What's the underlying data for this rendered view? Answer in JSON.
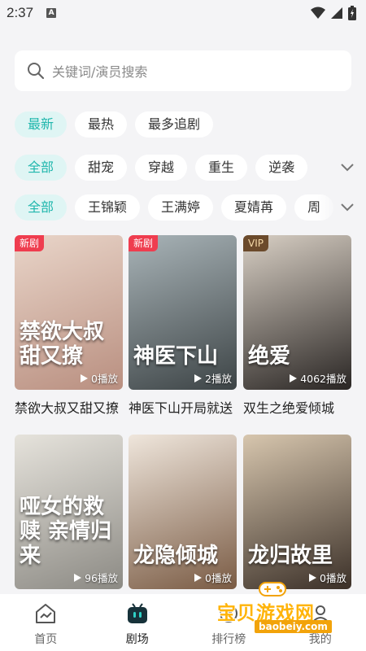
{
  "status": {
    "time": "2:37"
  },
  "search": {
    "placeholder": "关键词/演员搜索"
  },
  "sort_tabs": [
    {
      "label": "最新",
      "active": true
    },
    {
      "label": "最热",
      "active": false
    },
    {
      "label": "最多追剧",
      "active": false
    }
  ],
  "genre_tabs": [
    {
      "label": "全部",
      "active": true
    },
    {
      "label": "甜宠",
      "active": false
    },
    {
      "label": "穿越",
      "active": false
    },
    {
      "label": "重生",
      "active": false
    },
    {
      "label": "逆袭",
      "active": false
    }
  ],
  "actor_tabs": [
    {
      "label": "全部",
      "active": true
    },
    {
      "label": "王锦颖",
      "active": false
    },
    {
      "label": "王满婷",
      "active": false
    },
    {
      "label": "夏婧苒",
      "active": false
    },
    {
      "label": "周",
      "active": false
    }
  ],
  "dramas": [
    {
      "title": "禁欲大叔又甜又撩",
      "badge": "新剧",
      "badge_type": "new",
      "poster_text": "禁欲大叔 甜又撩",
      "plays": "0播放",
      "colors": [
        "#e9d5c9",
        "#b98f80"
      ]
    },
    {
      "title": "神医下山开局就送",
      "badge": "新剧",
      "badge_type": "new",
      "poster_text": "神医下山",
      "plays": "2播放",
      "colors": [
        "#a9b4b8",
        "#3d4446"
      ]
    },
    {
      "title": "双生之绝爱倾城",
      "badge": "VIP",
      "badge_type": "vip",
      "poster_text": "绝爱",
      "plays": "4062播放",
      "colors": [
        "#d8cfc4",
        "#2a2624"
      ]
    },
    {
      "title": "",
      "badge": "",
      "badge_type": "",
      "poster_text": "哑女的救赎 亲情归来",
      "plays": "96播放",
      "colors": [
        "#e6e3dc",
        "#8c8a84"
      ]
    },
    {
      "title": "",
      "badge": "",
      "badge_type": "",
      "poster_text": "龙隐倾城",
      "plays": "0播放",
      "colors": [
        "#efe6dc",
        "#7a5b44"
      ]
    },
    {
      "title": "",
      "badge": "",
      "badge_type": "",
      "poster_text": "龙归故里",
      "plays": "0播放",
      "colors": [
        "#d7c6ae",
        "#3b3028"
      ]
    }
  ],
  "bottom_nav": [
    {
      "label": "首页",
      "icon": "home-icon",
      "active": false
    },
    {
      "label": "剧场",
      "icon": "theater-icon",
      "active": true
    },
    {
      "label": "排行榜",
      "icon": "ranking-icon",
      "active": false
    },
    {
      "label": "我的",
      "icon": "profile-icon",
      "active": false
    }
  ],
  "watermark": {
    "text": "宝贝游戏网",
    "url": "baobeiy.com"
  }
}
